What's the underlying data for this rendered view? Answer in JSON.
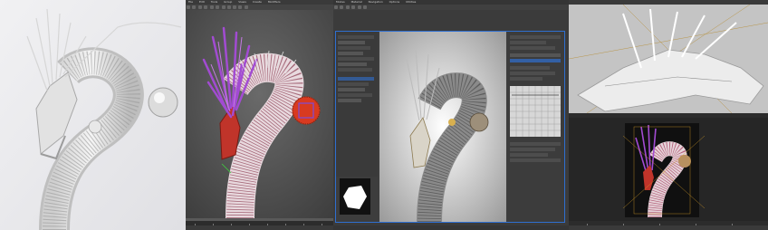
{
  "panels": {
    "render_left": {
      "bg": "#eaeaec",
      "object": "white dragon sculpture"
    },
    "viewport_main": {
      "bg": "#5e5e5e",
      "menu_labels": [
        "File",
        "Edit",
        "Tools",
        "Group",
        "Views",
        "Create",
        "Modifiers",
        "Animation",
        "Graph Editors",
        "Rendering",
        "Customize",
        "Scripting",
        "Help"
      ]
    },
    "material_editor": {
      "title": "",
      "menu_labels": [
        "Modes",
        "Material",
        "Navigation",
        "Options",
        "Utilities"
      ],
      "preview_bg": "#ffffff"
    },
    "render_setup": {
      "curve_graph": true
    },
    "viewport_right": {
      "top_bg": "#bcbcbc",
      "bottom_bg": "#2a2a2a"
    }
  },
  "colors": {
    "app_dark": "#3a3a3a",
    "accent_blue": "#2f6fd0",
    "hair_purple": "#a24bd2",
    "sphere_red": "#d83a20"
  }
}
